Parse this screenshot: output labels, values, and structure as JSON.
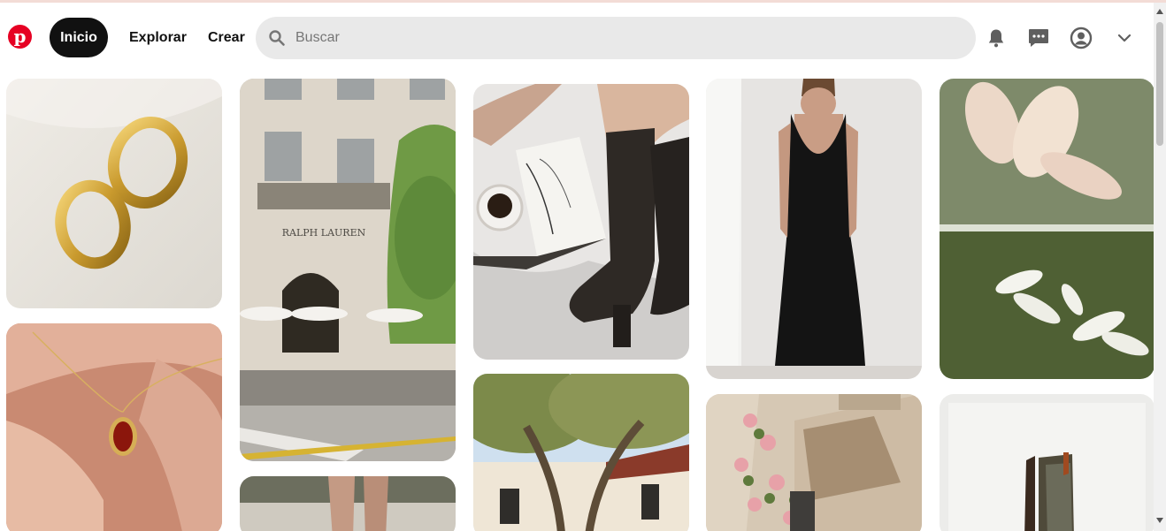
{
  "brand": {
    "accent": "#e60023"
  },
  "nav": {
    "home": "Inicio",
    "explore": "Explorar",
    "create": "Crear"
  },
  "search": {
    "placeholder": "Buscar"
  },
  "header_icons": [
    "bell-icon",
    "chat-icon",
    "user-circle-icon",
    "chevron-down-icon"
  ],
  "pins": [
    {
      "subject": "gold hoop earrings on silk"
    },
    {
      "subject": "Ralph Lauren storefront"
    },
    {
      "subject": "black leather boots with magazine"
    },
    {
      "subject": "black slip dress"
    },
    {
      "subject": "magnolia flowers collage"
    },
    {
      "subject": "red stone pendant necklace"
    },
    {
      "subject": "legs on sidewalk"
    },
    {
      "subject": "trees and white villa"
    },
    {
      "subject": "roses on beige building"
    },
    {
      "subject": "sunglasses on white backdrop"
    }
  ],
  "brand_signage": "RALPH LAUREN"
}
